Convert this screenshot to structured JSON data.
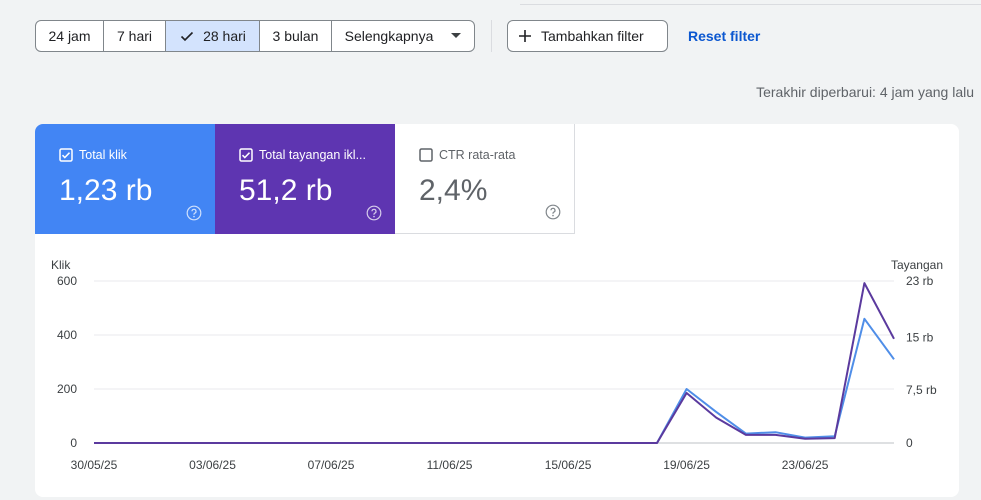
{
  "date_range": {
    "options": [
      {
        "label": "24 jam",
        "selected": false
      },
      {
        "label": "7 hari",
        "selected": false
      },
      {
        "label": "28 hari",
        "selected": true
      },
      {
        "label": "3 bulan",
        "selected": false
      }
    ],
    "more_label": "Selengkapnya"
  },
  "filters": {
    "add_label": "Tambahkan filter",
    "reset_label": "Reset filter"
  },
  "last_updated": "Terakhir diperbarui: 4 jam yang lalu",
  "metrics": [
    {
      "label": "Total klik",
      "value": "1,23 rb",
      "checked": true,
      "color": "#4285f4"
    },
    {
      "label": "Total tayangan ikl...",
      "value": "51,2 rb",
      "checked": true,
      "color": "#5e35b1"
    },
    {
      "label": "CTR rata-rata",
      "value": "2,4%",
      "checked": false,
      "color": "#ffffff"
    }
  ],
  "chart_data": {
    "type": "line",
    "left_axis_label": "Klik",
    "right_axis_label": "Tayangan",
    "left_ylim": [
      0,
      600
    ],
    "right_ylim": [
      0,
      23000
    ],
    "left_ticks": [
      {
        "value": 600,
        "label": "600"
      },
      {
        "value": 400,
        "label": "400"
      },
      {
        "value": 200,
        "label": "200"
      },
      {
        "value": 0,
        "label": "0"
      }
    ],
    "right_ticks": [
      {
        "value": 23000,
        "label": "23 rb"
      },
      {
        "value": 15000,
        "label": "15 rb"
      },
      {
        "value": 7500,
        "label": "7,5 rb"
      },
      {
        "value": 0,
        "label": "0"
      }
    ],
    "x_labels": [
      "30/05/25",
      "03/06/25",
      "07/06/25",
      "11/06/25",
      "15/06/25",
      "19/06/25",
      "23/06/25"
    ],
    "x_label_every": 4,
    "grid": true,
    "series": [
      {
        "name": "Total klik",
        "axis": "left",
        "color": "#4f8ee8",
        "values": [
          0,
          0,
          0,
          0,
          0,
          0,
          0,
          0,
          0,
          0,
          0,
          0,
          0,
          0,
          0,
          0,
          0,
          0,
          0,
          0,
          200,
          115,
          35,
          40,
          20,
          25,
          460,
          310
        ]
      },
      {
        "name": "Total tayangan iklan",
        "axis": "right",
        "color": "#5b3a9e",
        "values": [
          0,
          0,
          0,
          0,
          0,
          0,
          0,
          0,
          0,
          0,
          0,
          0,
          0,
          0,
          0,
          0,
          0,
          0,
          0,
          0,
          7100,
          3600,
          1150,
          1150,
          600,
          700,
          22700,
          14800
        ]
      }
    ]
  }
}
